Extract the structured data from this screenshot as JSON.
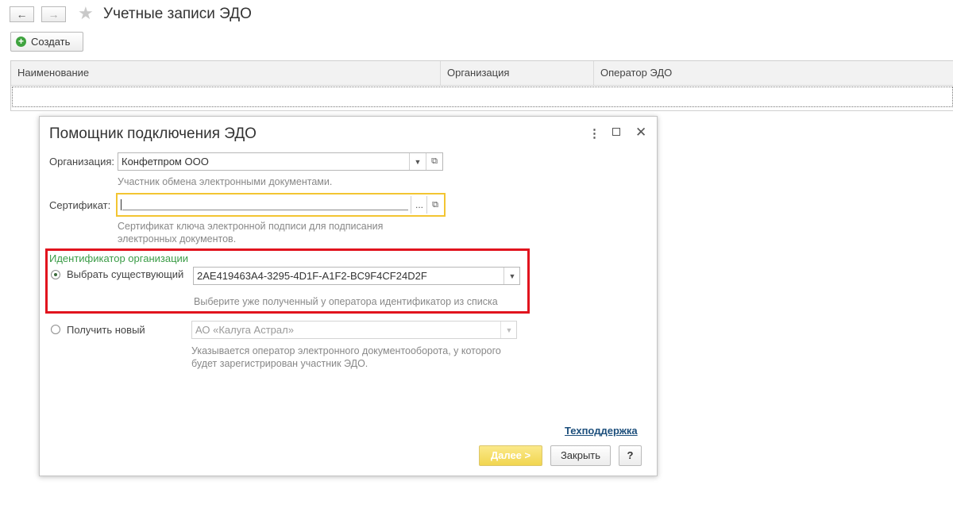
{
  "topbar": {
    "back_icon": "arrow-left-icon",
    "forward_icon": "arrow-right-icon",
    "favorite_icon": "star-icon",
    "title": "Учетные записи ЭДО"
  },
  "toolbar": {
    "create_label": "Создать"
  },
  "table": {
    "columns": [
      "Наименование",
      "Организация",
      "Оператор ЭДО"
    ]
  },
  "dialog": {
    "title": "Помощник подключения ЭДО",
    "controls": [
      "more-icon",
      "maximize-icon",
      "close-icon"
    ],
    "organization": {
      "label": "Организация:",
      "value": "Конфетпром ООО",
      "hint": "Участник обмена электронными документами."
    },
    "certificate": {
      "label": "Сертификат:",
      "value": "",
      "select_button": "...",
      "hint_line1": "Сертификат ключа электронной подписи для подписания",
      "hint_line2": "электронных документов."
    },
    "identifier": {
      "group_title": "Идентификатор организации",
      "existing_label": "Выбрать существующий",
      "existing_value": "2AE419463A4-3295-4D1F-A1F2-BC9F4CF24D2F",
      "existing_hint": "Выберите уже полученный у оператора идентификатор из списка",
      "new_label": "Получить новый",
      "new_value": "АО «Калуга Астрал»",
      "new_hint_line1": "Указывается оператор электронного документооборота, у которого",
      "new_hint_line2": "будет зарегистрирован участник ЭДО.",
      "selected": "existing"
    },
    "support_link": "Техподдержка",
    "buttons": {
      "next": "Далее >",
      "close": "Закрыть",
      "help": "?"
    }
  }
}
